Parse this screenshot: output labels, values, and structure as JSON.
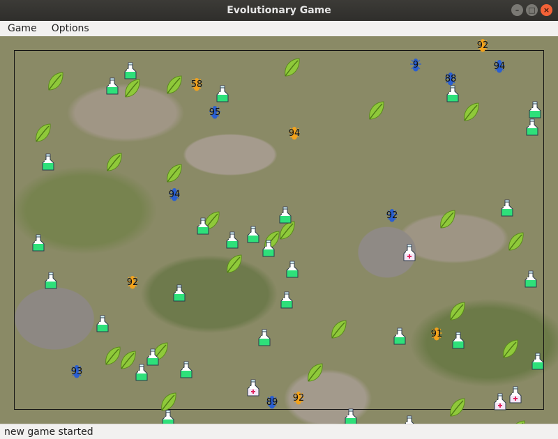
{
  "window": {
    "title": "Evolutionary Game"
  },
  "menu": {
    "items": [
      "Game",
      "Options"
    ]
  },
  "status": {
    "message": "new game started"
  },
  "colors": {
    "ant_orange": "#f2a21c",
    "ant_blue": "#2a5fd1",
    "potion_green": "#2ee07a",
    "potion_red_cross": "#e0245e",
    "leaf_green": "#8fc93a"
  },
  "icons": {
    "ant": "ant-icon",
    "food": "leaf-icon",
    "potion": "green-potion-icon",
    "medkit": "red-cross-potion-icon"
  },
  "ants": [
    {
      "label": "58",
      "color": "orange"
    },
    {
      "label": "95",
      "color": "blue"
    },
    {
      "label": "94",
      "color": "orange"
    },
    {
      "label": "94",
      "color": "blue"
    },
    {
      "label": "92",
      "color": "blue"
    },
    {
      "label": "92",
      "color": "orange"
    },
    {
      "label": "91",
      "color": "orange"
    },
    {
      "label": "93",
      "color": "blue"
    },
    {
      "label": "89",
      "color": "blue"
    },
    {
      "label": "92",
      "color": "orange"
    },
    {
      "label": "88",
      "color": "blue"
    },
    {
      "label": "94",
      "color": "blue"
    },
    {
      "label": "92",
      "color": "orange"
    },
    {
      "label": "9",
      "color": "blue"
    }
  ]
}
